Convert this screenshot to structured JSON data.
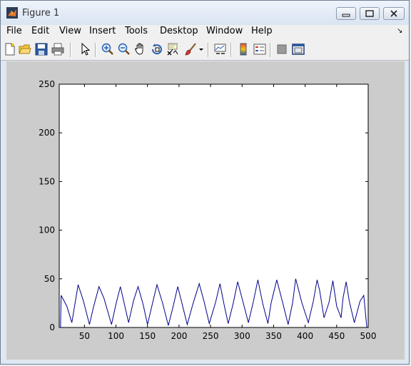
{
  "window": {
    "title": "Figure 1",
    "minimize_glyph": "▭",
    "maximize_glyph": "◻",
    "close_glyph": "✕"
  },
  "menubar": {
    "items": [
      "File",
      "Edit",
      "View",
      "Insert",
      "Tools",
      "Desktop",
      "Window",
      "Help"
    ],
    "overflow_glyph": "↘"
  },
  "toolbar": {
    "icons": [
      "new-figure-icon",
      "open-file-icon",
      "save-icon",
      "print-icon",
      "pointer-arrow-icon",
      "zoom-in-icon",
      "zoom-out-icon",
      "pan-hand-icon",
      "rotate-3d-icon",
      "data-cursor-icon",
      "brush-icon",
      "brush-dropdown-icon",
      "link-plot-icon",
      "colorbar-icon",
      "legend-icon",
      "hide-plot-tools-icon",
      "show-plot-tools-icon"
    ]
  },
  "colors": {
    "line": "#00008b",
    "figure_bg": "#cccccc",
    "axes_bg": "#ffffff"
  },
  "chart_data": {
    "type": "line",
    "title": "",
    "xlabel": "",
    "ylabel": "",
    "xlim": [
      10,
      500
    ],
    "ylim": [
      0,
      250
    ],
    "xticks": [
      50,
      100,
      150,
      200,
      250,
      300,
      350,
      400,
      450,
      500
    ],
    "yticks": [
      0,
      50,
      100,
      150,
      200,
      250
    ],
    "grid": false,
    "series": [
      {
        "x": [
          10,
          12,
          13,
          22,
          30,
          40,
          48,
          58,
          64,
          73,
          81,
          93,
          100,
          107,
          113,
          120,
          128,
          135,
          143,
          150,
          158,
          165,
          174,
          183,
          190,
          198,
          205,
          213,
          222,
          232,
          240,
          248,
          258,
          265,
          271,
          278,
          286,
          293,
          302,
          310,
          318,
          325,
          333,
          341,
          346,
          355,
          365,
          373,
          380,
          385,
          395,
          405,
          413,
          419,
          423,
          430,
          438,
          444,
          450,
          457,
          460,
          465,
          470,
          478,
          487,
          493,
          497,
          498
        ],
        "y": [
          0,
          0,
          33,
          22,
          5,
          44,
          28,
          3,
          20,
          42,
          30,
          3,
          24,
          42,
          25,
          5,
          28,
          42,
          24,
          3,
          25,
          44,
          25,
          2,
          20,
          42,
          24,
          3,
          24,
          45,
          26,
          4,
          26,
          45,
          25,
          4,
          25,
          47,
          25,
          5,
          27,
          49,
          24,
          4,
          25,
          49,
          24,
          3,
          25,
          50,
          25,
          5,
          27,
          49,
          38,
          10,
          26,
          48,
          22,
          10,
          30,
          47,
          27,
          5,
          27,
          33,
          6,
          0
        ]
      }
    ]
  }
}
